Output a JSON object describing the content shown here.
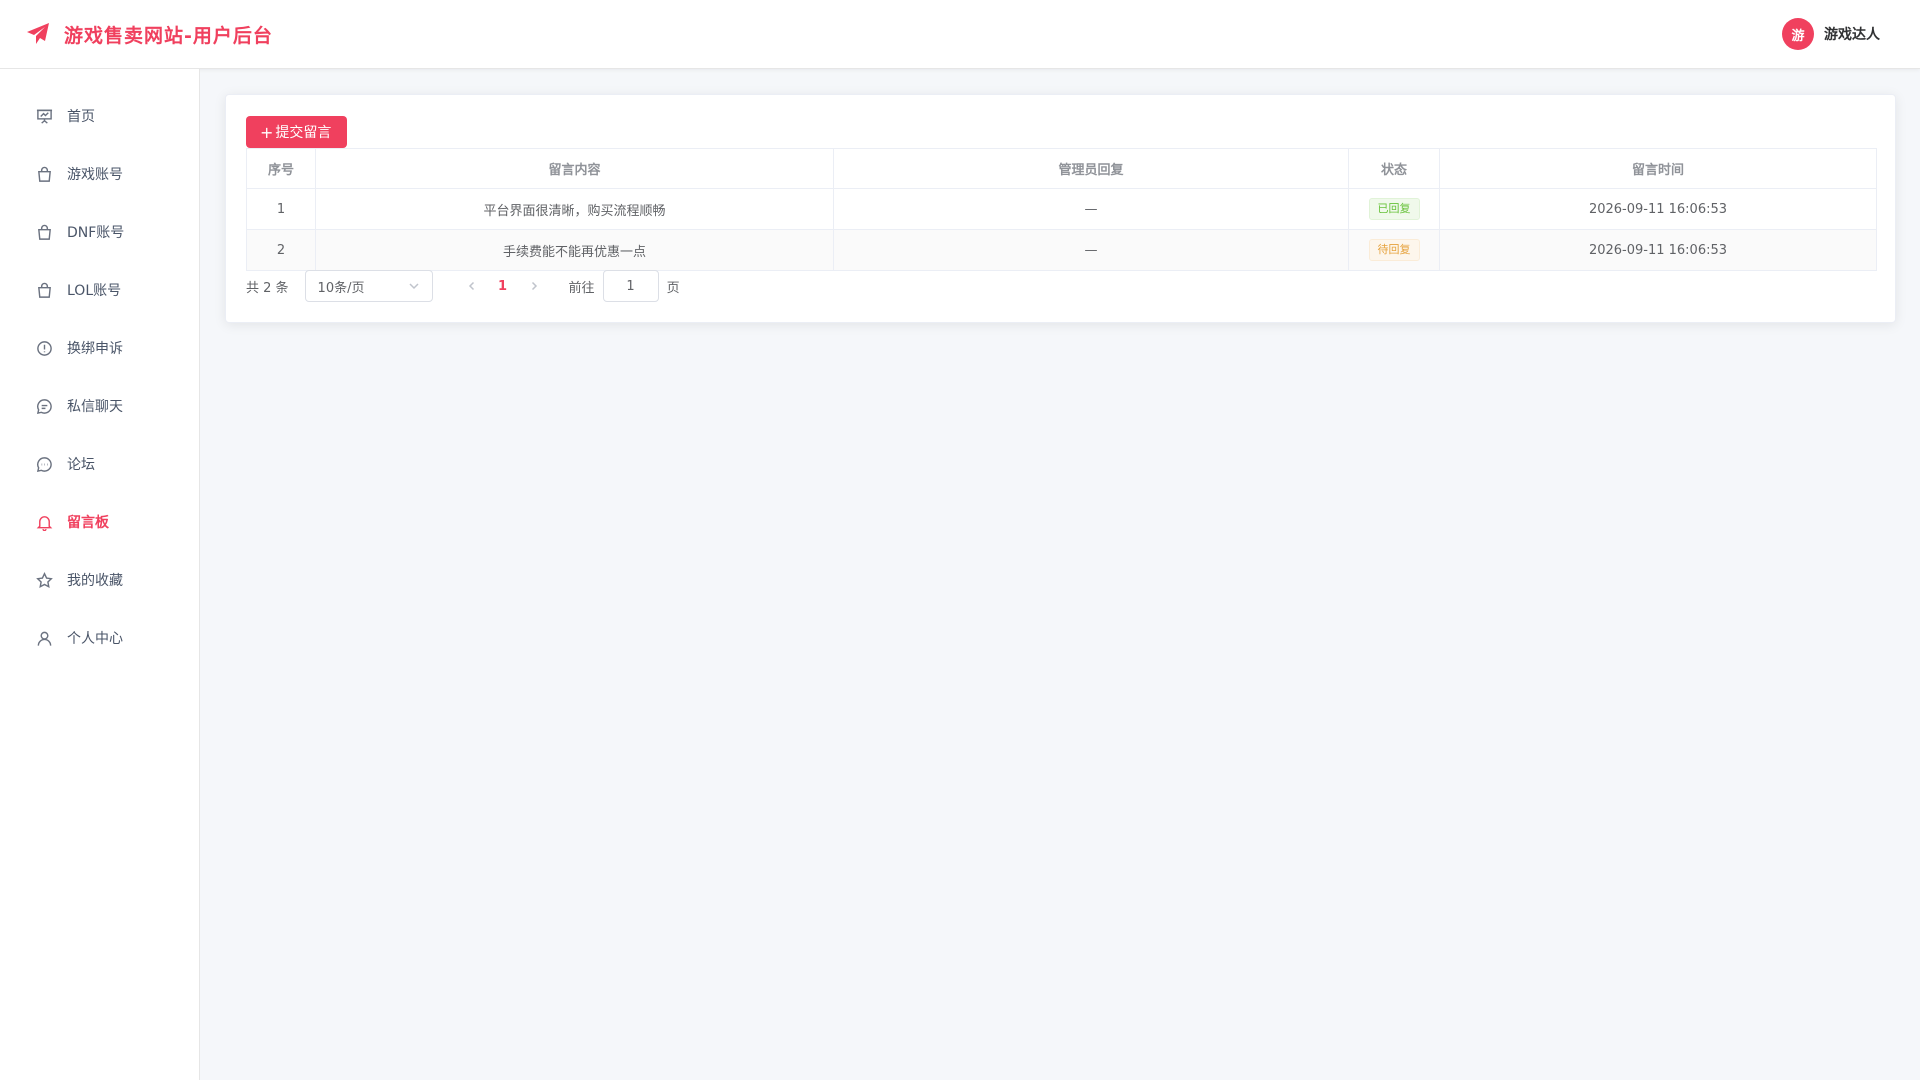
{
  "header": {
    "title": "游戏售卖网站-用户后台",
    "avatar_char": "游",
    "user_name": "游戏达人"
  },
  "sidebar": {
    "items": [
      {
        "label": "首页",
        "icon": "presentation-board-icon"
      },
      {
        "label": "游戏账号",
        "icon": "shopping-bag-icon"
      },
      {
        "label": "DNF账号",
        "icon": "shopping-bag-icon"
      },
      {
        "label": "LOL账号",
        "icon": "shopping-bag-icon"
      },
      {
        "label": "换绑申诉",
        "icon": "warning-circle-icon"
      },
      {
        "label": "私信聊天",
        "icon": "chat-bubble-icon"
      },
      {
        "label": "论坛",
        "icon": "chat-dots-icon"
      },
      {
        "label": "留言板",
        "icon": "bell-icon",
        "active": true
      },
      {
        "label": "我的收藏",
        "icon": "star-icon"
      },
      {
        "label": "个人中心",
        "icon": "user-icon"
      }
    ]
  },
  "toolbar": {
    "submit_label": "提交留言"
  },
  "table": {
    "headers": [
      "序号",
      "留言内容",
      "管理员回复",
      "状态",
      "留言时间"
    ],
    "rows": [
      {
        "index": "1",
        "content": "平台界面很清晰，购买流程顺畅",
        "reply": "—",
        "status": "已回复",
        "time": "2026-09-11 16:06:53"
      },
      {
        "index": "2",
        "content": "手续费能不能再优惠一点",
        "reply": "—",
        "status": "待回复",
        "time": "2026-09-11 16:06:53"
      }
    ]
  },
  "pagination": {
    "total": "共 2 条",
    "page_size": "10条/页",
    "current_page": "1",
    "goto_label": "前往",
    "goto_value": "1",
    "page_suffix": "页"
  },
  "colors": {
    "accent": "#f0405e",
    "success": "#67c23a",
    "warning": "#e6a23c"
  }
}
